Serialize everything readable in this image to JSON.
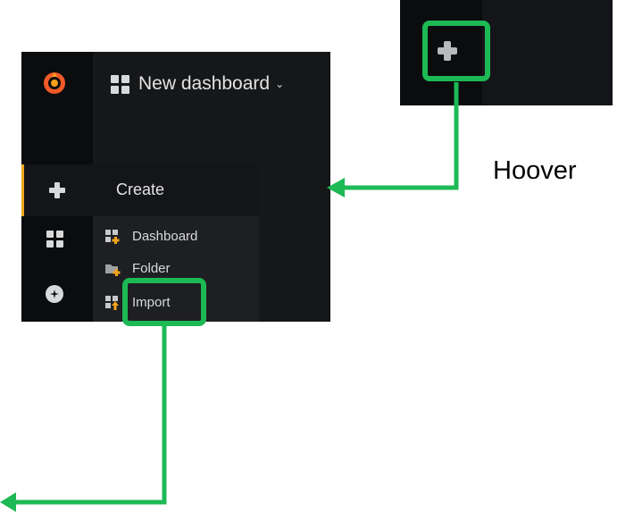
{
  "topbar": {
    "title": "New dashboard",
    "caret": "⌄"
  },
  "create_menu": {
    "title": "Create",
    "items": [
      {
        "label": "Dashboard",
        "icon": "dashboard-plus-icon"
      },
      {
        "label": "Folder",
        "icon": "folder-plus-icon"
      },
      {
        "label": "Import",
        "icon": "import-icon"
      }
    ]
  },
  "annotation": {
    "hover_label": "Hoover"
  },
  "colors": {
    "highlight": "#1db954",
    "accent": "#f2a41c",
    "panel_bg": "#161719",
    "sidebar_bg": "#0b0c0e"
  }
}
